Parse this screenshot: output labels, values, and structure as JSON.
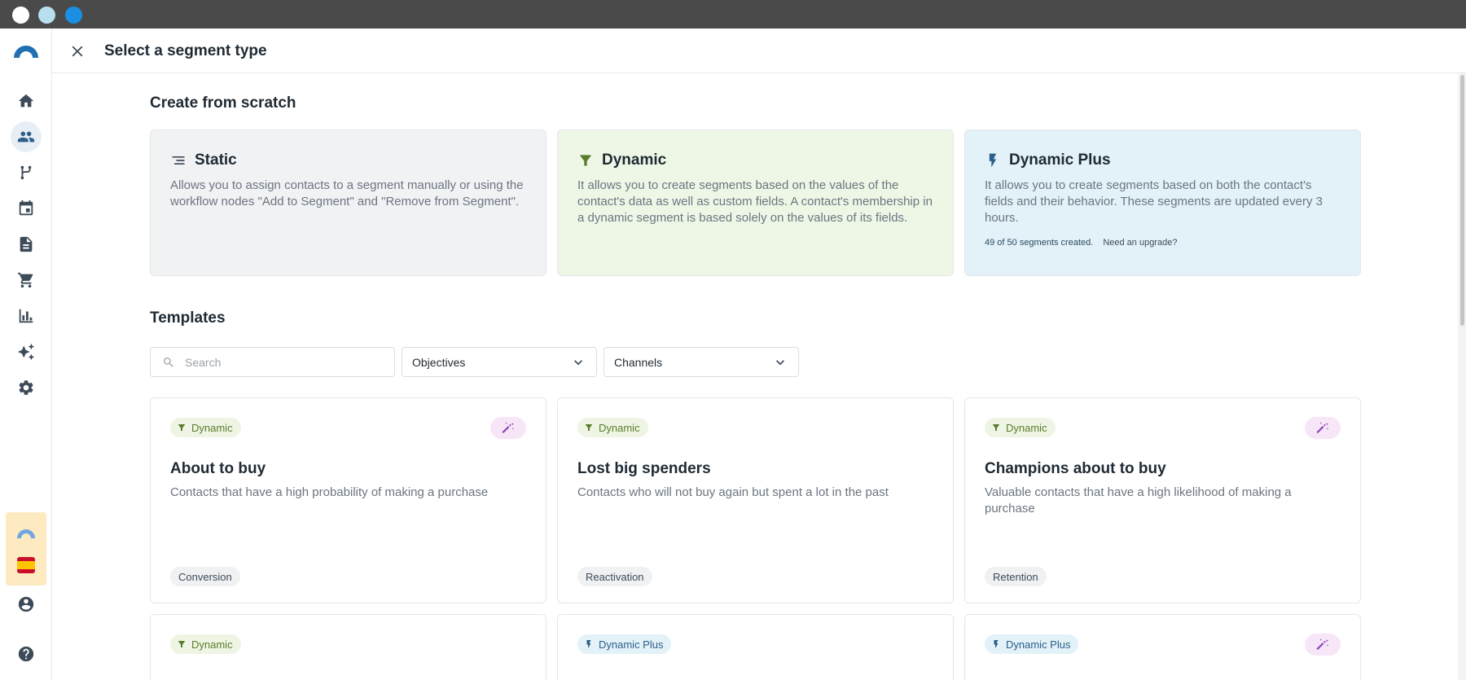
{
  "window": {
    "controls": [
      "close",
      "minimize",
      "maximize"
    ]
  },
  "rail": {
    "logo": "brand-logo",
    "items": [
      {
        "name": "home-icon",
        "active": false
      },
      {
        "name": "contacts-icon",
        "active": true
      },
      {
        "name": "workflow-icon",
        "active": false
      },
      {
        "name": "calendar-icon",
        "active": false
      },
      {
        "name": "document-icon",
        "active": false
      },
      {
        "name": "cart-icon",
        "active": false
      },
      {
        "name": "chart-icon",
        "active": false
      },
      {
        "name": "sparkle-icon",
        "active": false
      },
      {
        "name": "gear-icon",
        "active": false
      }
    ],
    "bottom": [
      "account-icon",
      "help-icon"
    ],
    "promo_flag": "spain-flag"
  },
  "header": {
    "title": "Select a segment type"
  },
  "scratch": {
    "title": "Create from scratch",
    "static": {
      "title": "Static",
      "desc": "Allows you to assign contacts to a segment manually or using the workflow nodes \"Add to Segment\" and \"Remove from Segment\"."
    },
    "dynamic": {
      "title": "Dynamic",
      "desc": "It allows you to create segments based on the values of the contact's data as well as custom fields. A contact's membership in a dynamic segment is based solely on the values of its fields."
    },
    "plus": {
      "title": "Dynamic Plus",
      "desc": "It allows you to create segments based on both the contact's fields and their behavior. These segments are updated every 3 hours.",
      "quota": "49 of 50 segments created.",
      "upgrade": "Need an upgrade?"
    }
  },
  "templates": {
    "title": "Templates",
    "search_placeholder": "Search",
    "objectives_label": "Objectives",
    "channels_label": "Channels",
    "cards": [
      {
        "badge": "Dynamic",
        "title": "About to buy",
        "desc": "Contacts that have a high probability of making a purchase",
        "tag": "Conversion"
      },
      {
        "badge": "Dynamic",
        "title": "Lost big spenders",
        "desc": "Contacts who will not buy again but spent a lot in the past",
        "tag": "Reactivation"
      },
      {
        "badge": "Dynamic",
        "title": "Champions about to buy",
        "desc": "Valuable contacts that have a high likelihood of making a purchase",
        "tag": "Retention"
      },
      {
        "badge": "Dynamic"
      },
      {
        "badge": "Dynamic Plus"
      },
      {
        "badge": "Dynamic Plus"
      }
    ]
  },
  "colors": {
    "dynamic": "#5a7d2c",
    "dynamic_plus": "#2b5f8a",
    "ai_chip": "#8e3bbf",
    "promo_bg": "#fdeac0"
  }
}
